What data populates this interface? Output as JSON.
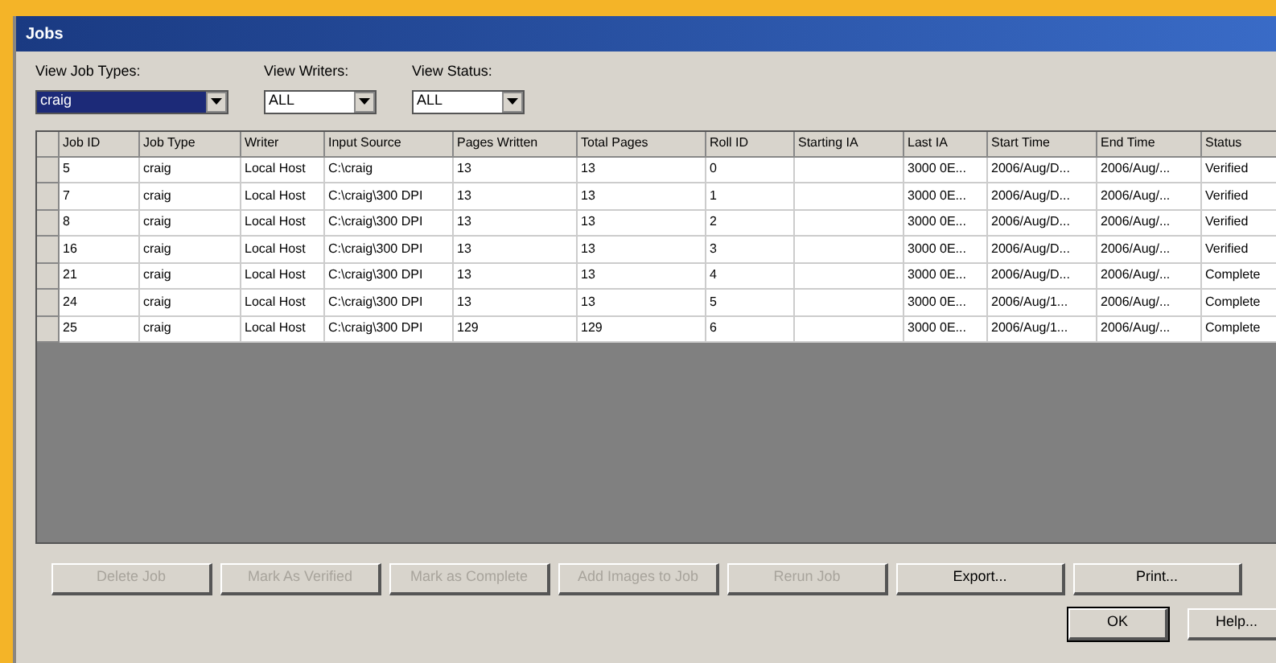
{
  "window": {
    "title": "Jobs"
  },
  "filters": [
    {
      "label": "View Job Types:",
      "value": "craig",
      "focused": true
    },
    {
      "label": "View Writers:",
      "value": "ALL",
      "focused": false
    },
    {
      "label": "View Status:",
      "value": "ALL",
      "focused": false
    }
  ],
  "table": {
    "columns": [
      "Job ID",
      "Job Type",
      "Writer",
      "Input Source",
      "Pages Written",
      "Total Pages",
      "Roll ID",
      "Starting IA",
      "Last IA",
      "Start Time",
      "End Time",
      "Status"
    ],
    "rows": [
      [
        "5",
        "craig",
        "Local Host",
        "C:\\craig",
        "13",
        "13",
        "0",
        "",
        "3000 0E...",
        "2006/Aug/D...",
        "2006/Aug/...",
        "Verified"
      ],
      [
        "7",
        "craig",
        "Local Host",
        "C:\\craig\\300 DPI",
        "13",
        "13",
        "1",
        "",
        "3000 0E...",
        "2006/Aug/D...",
        "2006/Aug/...",
        "Verified"
      ],
      [
        "8",
        "craig",
        "Local Host",
        "C:\\craig\\300 DPI",
        "13",
        "13",
        "2",
        "",
        "3000 0E...",
        "2006/Aug/D...",
        "2006/Aug/...",
        "Verified"
      ],
      [
        "16",
        "craig",
        "Local Host",
        "C:\\craig\\300 DPI",
        "13",
        "13",
        "3",
        "",
        "3000 0E...",
        "2006/Aug/D...",
        "2006/Aug/...",
        "Verified"
      ],
      [
        "21",
        "craig",
        "Local Host",
        "C:\\craig\\300 DPI",
        "13",
        "13",
        "4",
        "",
        "3000 0E...",
        "2006/Aug/D...",
        "2006/Aug/...",
        "Complete"
      ],
      [
        "24",
        "craig",
        "Local Host",
        "C:\\craig\\300 DPI",
        "13",
        "13",
        "5",
        "",
        "3000 0E...",
        "2006/Aug/1...",
        "2006/Aug/...",
        "Complete"
      ],
      [
        "25",
        "craig",
        "Local Host",
        "C:\\craig\\300 DPI",
        "129",
        "129",
        "6",
        "",
        "3000 0E...",
        "2006/Aug/1...",
        "2006/Aug/...",
        "Complete"
      ]
    ]
  },
  "actions": [
    {
      "label": "Delete Job",
      "disabled": true
    },
    {
      "label": "Mark As Verified",
      "disabled": true
    },
    {
      "label": "Mark as Complete",
      "disabled": true
    },
    {
      "label": "Add Images to Job",
      "disabled": true
    },
    {
      "label": "Rerun Job",
      "disabled": true
    },
    {
      "label": "Export...",
      "disabled": false
    },
    {
      "label": "Print...",
      "disabled": false
    }
  ],
  "dialog_buttons": [
    {
      "label": "OK",
      "default": true
    },
    {
      "label": "Help...",
      "default": false
    }
  ]
}
